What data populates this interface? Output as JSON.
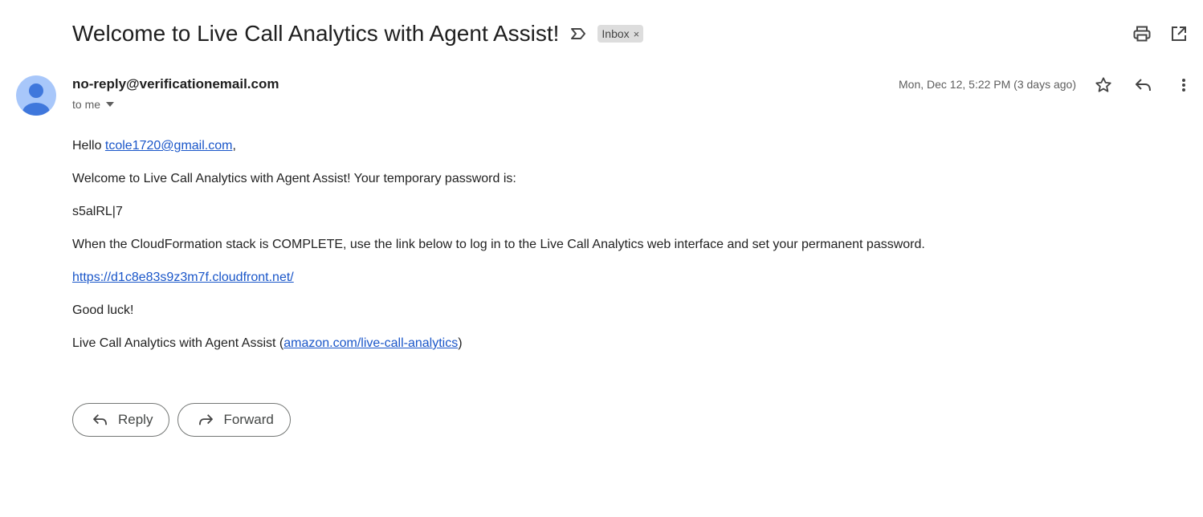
{
  "email": {
    "subject": "Welcome to Live Call Analytics with Agent Assist!",
    "label": "Inbox",
    "label_close": "×",
    "sender": "no-reply@verificationemail.com",
    "recipient": "to me",
    "date": "Mon, Dec 12, 5:22 PM (3 days ago)"
  },
  "body": {
    "greeting_prefix": "Hello ",
    "greeting_email": "tcole1720@gmail.com",
    "greeting_suffix": ",",
    "welcome": "Welcome to Live Call Analytics with Agent Assist! Your temporary password is:",
    "password": "s5alRL|7",
    "instructions": "When the CloudFormation stack is COMPLETE, use the link below to log in to the Live Call Analytics web interface and set your permanent password.",
    "link": "https://d1c8e83s9z3m7f.cloudfront.net/",
    "closing": "Good luck!",
    "signature_prefix": "Live Call Analytics with Agent Assist (",
    "signature_link": "amazon.com/live-call-analytics",
    "signature_suffix": ")"
  },
  "buttons": {
    "reply": "Reply",
    "forward": "Forward"
  },
  "icons": {
    "important": "important-marker-icon",
    "print": "print-icon",
    "open_new_window": "open-in-new-window-icon",
    "star": "star-icon",
    "reply": "reply-icon",
    "more": "more-vertical-icon",
    "caret": "caret-down-icon",
    "avatar": "person-avatar-icon",
    "forward": "forward-icon"
  },
  "colors": {
    "link": "#1a56c9",
    "avatar_bg": "#a8c7fa",
    "avatar_fg": "#3f77dc",
    "chip_bg": "#dddddd"
  }
}
